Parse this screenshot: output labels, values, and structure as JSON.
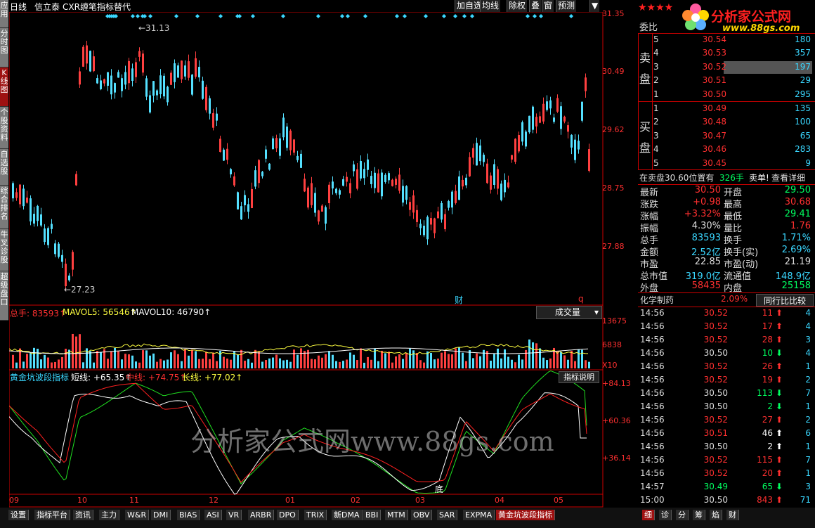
{
  "header": {
    "period": "日线",
    "stock": "信立泰",
    "indicator": "CXR缠笔指标替代",
    "buttons": [
      "加自选",
      "均线",
      "除权",
      "叠",
      "窗",
      "预测"
    ],
    "menu_arrow": "▼"
  },
  "sidebar": [
    "应用",
    "分时图",
    "K线图",
    "个股资料",
    "自选股",
    "综合排名",
    "牛叉诊股",
    "超级盘口"
  ],
  "chart": {
    "price_axis": [
      "31.35",
      "30.49",
      "29.62",
      "28.75",
      "27.88"
    ],
    "high_label": "←31.13",
    "low_label": "←27.23",
    "marker_cai": "财",
    "marker_q": "q",
    "vol_header": {
      "a": "总手: 83593↑",
      "b": "MAVOL5: 56546↑",
      "c": "MAVOL10: 46790↑"
    },
    "vol_select": "成交量",
    "vol_axis": [
      "13675",
      "6838",
      "X10"
    ],
    "ind_header": {
      "name": "黄金坑波段指标",
      "s": "短线: +65.35↑",
      "m": "中线: +74.75↑",
      "l": "长线: +77.02↑"
    },
    "ind_button": "指标说明",
    "ind_axis": [
      "+84.13",
      "+60.36",
      "+36.14"
    ],
    "ind_label": "底",
    "x_axis": [
      "09",
      "10",
      "11",
      "12",
      "01",
      "02",
      "03",
      "04",
      "05"
    ],
    "watermark": "分析家公式网www.88gs.com"
  },
  "right": {
    "stars": "★★★★",
    "logo_text": "分析家公式网",
    "logo_url": "www.88gs.com",
    "weibi": "委比",
    "sell_label": "卖盘",
    "buy_label": "买盘",
    "sell": [
      [
        "5",
        "30.54",
        "180"
      ],
      [
        "4",
        "30.53",
        "357"
      ],
      [
        "3",
        "30.52",
        "197"
      ],
      [
        "2",
        "30.51",
        "29"
      ],
      [
        "1",
        "30.50",
        "295"
      ]
    ],
    "buy": [
      [
        "1",
        "30.49",
        "135"
      ],
      [
        "2",
        "30.48",
        "100"
      ],
      [
        "3",
        "30.47",
        "65"
      ],
      [
        "4",
        "30.46",
        "283"
      ],
      [
        "5",
        "30.45",
        "9"
      ]
    ],
    "info": {
      "a": "在卖盘30.60位置有",
      "b": "326手",
      "c": "卖单!",
      "d": "查看详细"
    },
    "quote": [
      [
        "最新",
        "30.50",
        "开盘",
        "29.50"
      ],
      [
        "涨跌",
        "+0.98",
        "最高",
        "30.68"
      ],
      [
        "涨幅",
        "+3.32%",
        "最低",
        "29.41"
      ],
      [
        "振幅",
        "4.30%",
        "量比",
        "1.76"
      ],
      [
        "总手",
        "83593",
        "换手",
        "1.71%"
      ],
      [
        "金额",
        "2.52亿",
        "换手(实)",
        "2.69%"
      ],
      [
        "市盈",
        "22.85",
        "市盈(动)",
        "21.19"
      ],
      [
        "总市值",
        "319.0亿",
        "流通值",
        "148.9亿"
      ],
      [
        "外盘",
        "58435",
        "内盘",
        "25158"
      ]
    ],
    "sector": {
      "name": "化学制药",
      "pct": "2.09%",
      "btn": "同行比比较"
    },
    "ticks": [
      [
        "14:56",
        "30.52",
        "11",
        "up",
        "4"
      ],
      [
        "14:56",
        "30.52",
        "17",
        "up",
        "4"
      ],
      [
        "14:56",
        "30.52",
        "28",
        "up",
        "3"
      ],
      [
        "14:56",
        "30.50",
        "10",
        "down",
        "4"
      ],
      [
        "14:56",
        "30.52",
        "26",
        "up",
        "1"
      ],
      [
        "14:56",
        "30.52",
        "19",
        "up",
        "2"
      ],
      [
        "14:56",
        "30.50",
        "113",
        "down",
        "7"
      ],
      [
        "14:56",
        "30.50",
        "2",
        "down",
        "1"
      ],
      [
        "14:56",
        "30.52",
        "27",
        "up",
        "2"
      ],
      [
        "14:56",
        "30.51",
        "46",
        "upw",
        "6"
      ],
      [
        "14:56",
        "30.50",
        "2",
        "upw",
        "1"
      ],
      [
        "14:56",
        "30.52",
        "115",
        "up",
        "7"
      ],
      [
        "14:56",
        "30.52",
        "20",
        "up",
        "1"
      ],
      [
        "14:57",
        "30.49",
        "65",
        "down",
        "3"
      ],
      [
        "15:00",
        "30.50",
        "843",
        "up",
        "71"
      ]
    ]
  },
  "bottom_tabs": [
    "设置",
    "指标平台",
    "资讯",
    "主力",
    "W&R",
    "DMI",
    "BIAS",
    "ASI",
    "VR",
    "ARBR",
    "DPO",
    "TRIX",
    "新DMA",
    "BBI",
    "MTM",
    "OBV",
    "SAR",
    "EXPMA",
    "黄金坑波段指标"
  ],
  "bottom_right_tabs": [
    "细",
    "诊",
    "分",
    "筹",
    "焰",
    "财"
  ]
}
